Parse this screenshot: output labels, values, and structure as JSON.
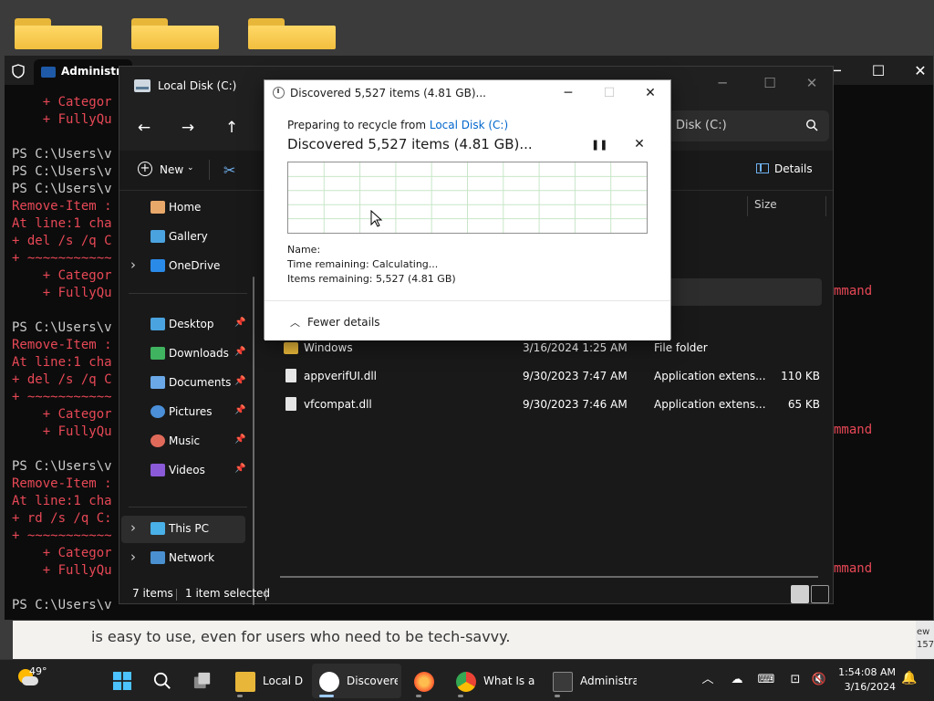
{
  "powershell": {
    "tab_title": "Administra",
    "lines": [
      {
        "text": "    + Categor",
        "color": "red"
      },
      {
        "text": "    + FullyQu",
        "color": "red"
      },
      {
        "text": "",
        "color": "white"
      },
      {
        "text": "PS C:\\Users\\v",
        "color": "white"
      },
      {
        "text": "PS C:\\Users\\v",
        "color": "white"
      },
      {
        "text": "PS C:\\Users\\v",
        "color": "white"
      },
      {
        "text": "Remove-Item :",
        "color": "red"
      },
      {
        "text": "At line:1 cha",
        "color": "red"
      },
      {
        "text": "+ del /s /q C",
        "color": "red"
      },
      {
        "text": "+ ~~~~~~~~~~~",
        "color": "red"
      },
      {
        "text": "    + Categor",
        "color": "red"
      },
      {
        "text": "    + FullyQu",
        "color": "red"
      },
      {
        "text": "",
        "color": "white"
      },
      {
        "text": "PS C:\\Users\\v",
        "color": "white"
      },
      {
        "text": "Remove-Item :",
        "color": "red"
      },
      {
        "text": "At line:1 cha",
        "color": "red"
      },
      {
        "text": "+ del /s /q C",
        "color": "red"
      },
      {
        "text": "+ ~~~~~~~~~~~",
        "color": "red"
      },
      {
        "text": "    + Categor",
        "color": "red"
      },
      {
        "text": "    + FullyQu",
        "color": "red"
      },
      {
        "text": "",
        "color": "white"
      },
      {
        "text": "PS C:\\Users\\v",
        "color": "white"
      },
      {
        "text": "Remove-Item :",
        "color": "red"
      },
      {
        "text": "At line:1 cha",
        "color": "red"
      },
      {
        "text": "+ rd /s /q C:",
        "color": "red"
      },
      {
        "text": "+ ~~~~~~~~~~~",
        "color": "red"
      },
      {
        "text": "    + Categor",
        "color": "red"
      },
      {
        "text": "    + FullyQu",
        "color": "red"
      },
      {
        "text": "",
        "color": "white"
      },
      {
        "text": "PS C:\\Users\\v",
        "color": "white"
      }
    ],
    "right_fragment": "mmand"
  },
  "browser": {
    "text": "is easy to use, even for users who need to be tech-savvy.",
    "right_edge": [
      "ew",
      "157"
    ]
  },
  "explorer": {
    "title": "Local Disk (C:)",
    "search_text": "Disk (C:)",
    "new_label": "New",
    "details_label": "Details",
    "sidebar": [
      {
        "label": "Home",
        "icon": "home-icon",
        "chevron": false,
        "pin": false
      },
      {
        "label": "Gallery",
        "icon": "gallery-icon",
        "chevron": false,
        "pin": false
      },
      {
        "label": "OneDrive",
        "icon": "onedrive-icon",
        "chevron": true,
        "pin": false
      },
      {
        "label": "Desktop",
        "icon": "desktop-icon",
        "chevron": false,
        "pin": true
      },
      {
        "label": "Downloads",
        "icon": "downloads-icon",
        "chevron": false,
        "pin": true
      },
      {
        "label": "Documents",
        "icon": "documents-icon",
        "chevron": false,
        "pin": true
      },
      {
        "label": "Pictures",
        "icon": "pictures-icon",
        "chevron": false,
        "pin": true
      },
      {
        "label": "Music",
        "icon": "music-icon",
        "chevron": false,
        "pin": true
      },
      {
        "label": "Videos",
        "icon": "videos-icon",
        "chevron": false,
        "pin": true
      },
      {
        "label": "This PC",
        "icon": "this-pc-icon",
        "chevron": true,
        "pin": false
      },
      {
        "label": "Network",
        "icon": "network-icon",
        "chevron": true,
        "pin": false
      }
    ],
    "columns": {
      "size": "Size"
    },
    "partial_rows": [
      {
        "type": "older"
      },
      {
        "type": "older"
      },
      {
        "type": "older"
      },
      {
        "type": "older"
      }
    ],
    "files": [
      {
        "name": "Windows",
        "date": "3/16/2024 1:25 AM",
        "type": "File folder",
        "size": "",
        "kind": "folder"
      },
      {
        "name": "appverifUI.dll",
        "date": "9/30/2023 7:47 AM",
        "type": "Application extens...",
        "size": "110 KB",
        "kind": "dll"
      },
      {
        "name": "vfcompat.dll",
        "date": "9/30/2023 7:46 AM",
        "type": "Application extens...",
        "size": "65 KB",
        "kind": "dll"
      }
    ],
    "status": {
      "items": "7 items",
      "selected": "1 item selected"
    }
  },
  "dialog": {
    "title": "Discovered 5,527 items (4.81 GB)...",
    "preparing_prefix": "Preparing to recycle from ",
    "source": "Local Disk (C:)",
    "heading": "Discovered 5,527 items (4.81 GB)...",
    "name_label": "Name:",
    "time_remaining_label": "Time remaining:",
    "time_remaining_value": "Calculating...",
    "items_remaining_label": "Items remaining:",
    "items_remaining_value": "5,527 (4.81 GB)",
    "fewer_details": "Fewer details",
    "graph_grid_color": "#c8e6c8"
  },
  "taskbar": {
    "weather_temp": "49°",
    "apps": [
      {
        "label": "Local Di",
        "icon": "file-explorer-icon",
        "active": false
      },
      {
        "label": "Discovere",
        "icon": "clock-icon",
        "active": true
      },
      {
        "label": "",
        "icon": "firefox-icon",
        "active": false
      },
      {
        "label": "What Is a",
        "icon": "chrome-icon",
        "active": false
      },
      {
        "label": "Administra",
        "icon": "terminal-icon",
        "active": false
      }
    ],
    "time": "1:54:08 AM",
    "date": "3/16/2024"
  },
  "colors": {
    "accent": "#6fb1f0",
    "ps_error": "#e74856",
    "folder": "#e8b73a",
    "link": "#0066cc"
  }
}
